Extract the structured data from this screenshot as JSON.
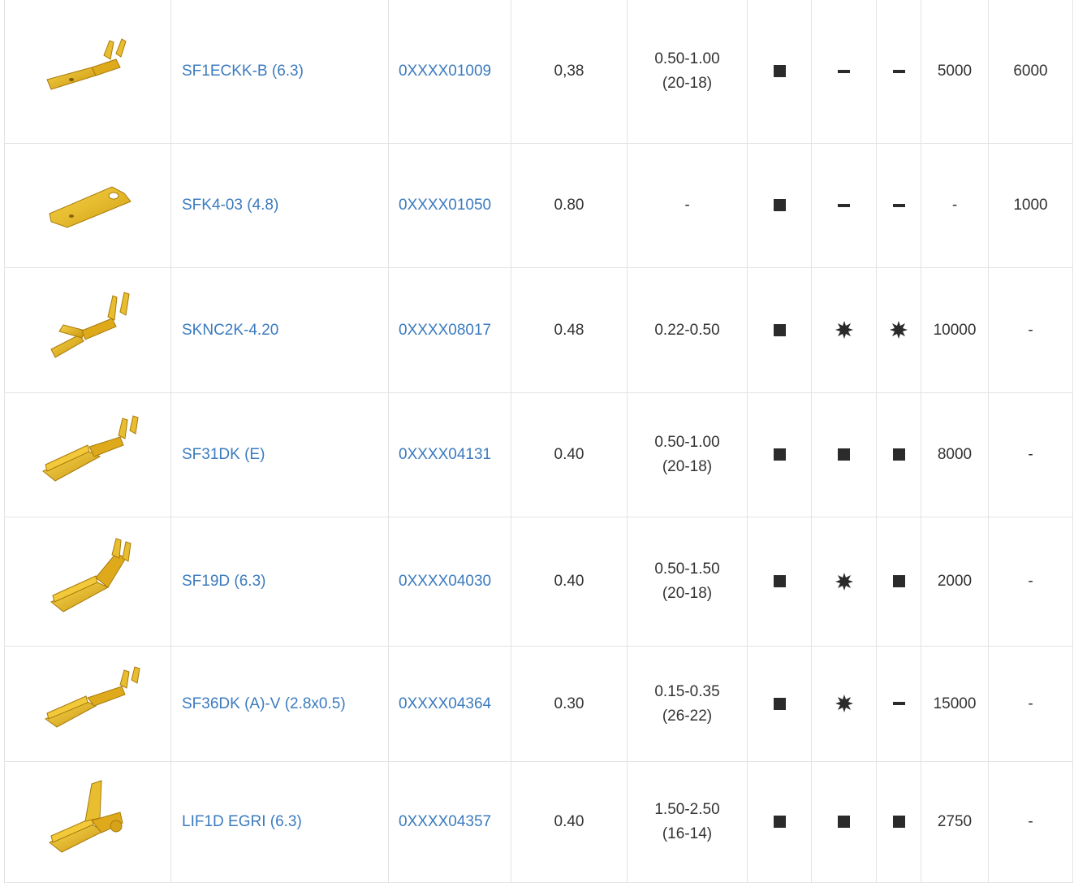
{
  "colors": {
    "link": "#3b7bbf",
    "border": "#e3e3e3",
    "brass": "#e8b820",
    "symbol": "#2b2b2b"
  },
  "symbol_legend": {
    "square": "filled-square",
    "dash": "dash",
    "star": "starburst"
  },
  "rows": [
    {
      "image": "terminal-ecc-icon",
      "name": "SF1ECKK-B (6.3)",
      "code": "0XXXX01009",
      "thickness": "0,38",
      "range_mm": "0.50-1.00",
      "range_awg": "(20-18)",
      "m1": "square",
      "m2": "dash",
      "m3": "dash",
      "qty1": "5000",
      "qty2": "6000"
    },
    {
      "image": "terminal-flat-tab-icon",
      "name": "SFK4-03 (4.8)",
      "code": "0XXXX01050",
      "thickness": "0.80",
      "range_mm": "-",
      "range_awg": "",
      "m1": "square",
      "m2": "dash",
      "m3": "dash",
      "qty1": "-",
      "qty2": "1000"
    },
    {
      "image": "terminal-fork-icon",
      "name": "SKNC2K-4.20",
      "code": "0XXXX08017",
      "thickness": "0.48",
      "range_mm": "0.22-0.50",
      "range_awg": "",
      "m1": "square",
      "m2": "star",
      "m3": "star",
      "qty1": "10000",
      "qty2": "-"
    },
    {
      "image": "terminal-female-icon",
      "name": "SF31DK (E)",
      "code": "0XXXX04131",
      "thickness": "0.40",
      "range_mm": "0.50-1.00",
      "range_awg": "(20-18)",
      "m1": "square",
      "m2": "square",
      "m3": "square",
      "qty1": "8000",
      "qty2": "-"
    },
    {
      "image": "terminal-female-flag-icon",
      "name": "SF19D (6.3)",
      "code": "0XXXX04030",
      "thickness": "0.40",
      "range_mm": "0.50-1.50",
      "range_awg": "(20-18)",
      "m1": "square",
      "m2": "star",
      "m3": "square",
      "qty1": "2000",
      "qty2": "-"
    },
    {
      "image": "terminal-female-small-icon",
      "name": "SF36DK (A)-V (2.8x0.5)",
      "code": "0XXXX04364",
      "thickness": "0.30",
      "range_mm": "0.15-0.35",
      "range_awg": "(26-22)",
      "m1": "square",
      "m2": "star",
      "m3": "dash",
      "qty1": "15000",
      "qty2": "-"
    },
    {
      "image": "terminal-female-flag-large-icon",
      "name": "LIF1D EGRI (6.3)",
      "code": "0XXXX04357",
      "thickness": "0.40",
      "range_mm": "1.50-2.50",
      "range_awg": "(16-14)",
      "m1": "square",
      "m2": "square",
      "m3": "square",
      "qty1": "2750",
      "qty2": "-"
    }
  ]
}
